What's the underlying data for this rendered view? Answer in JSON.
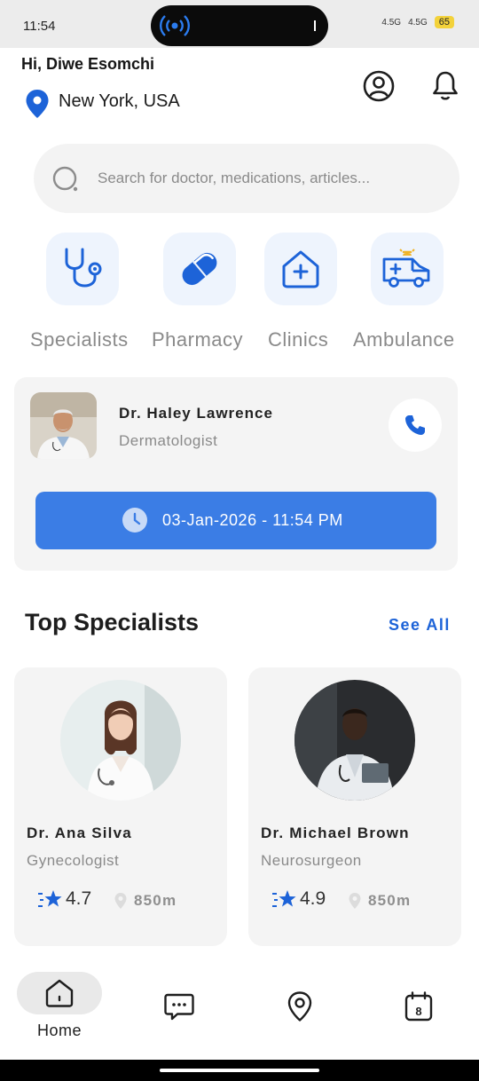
{
  "status_bar": {
    "time": "11:54",
    "network_left": "4.5G",
    "network_right": "4.5G",
    "battery": "65"
  },
  "header": {
    "greeting": "Hi, Diwe Esomchi",
    "location": "New York, USA"
  },
  "search": {
    "placeholder": "Search for doctor, medications, articles..."
  },
  "categories": [
    {
      "label": "Specialists",
      "icon": "stethoscope-icon"
    },
    {
      "label": "Pharmacy",
      "icon": "pill-icon"
    },
    {
      "label": "Clinics",
      "icon": "clinic-icon"
    },
    {
      "label": "Ambulance",
      "icon": "ambulance-icon"
    }
  ],
  "appointment": {
    "doctor_name": "Dr. Haley Lawrence",
    "specialty": "Dermatologist",
    "datetime": "03-Jan-2026 - 11:54 PM"
  },
  "top_specialists": {
    "title": "Top Specialists",
    "see_all": "See All",
    "doctors": [
      {
        "name": "Dr. Ana Silva",
        "specialty": "Gynecologist",
        "rating": "4.7",
        "distance": "850m"
      },
      {
        "name": "Dr. Michael Brown",
        "specialty": "Neurosurgeon",
        "rating": "4.9",
        "distance": "850m"
      }
    ]
  },
  "bottom_nav": {
    "home_label": "Home",
    "items": [
      "home-icon",
      "chat-icon",
      "location-icon",
      "calendar-icon"
    ],
    "calendar_day": "8"
  },
  "colors": {
    "accent": "#3b7de5",
    "accent_dark": "#1d63d8",
    "card_bg": "#f4f4f4",
    "icon_bg": "#eef4fd"
  }
}
